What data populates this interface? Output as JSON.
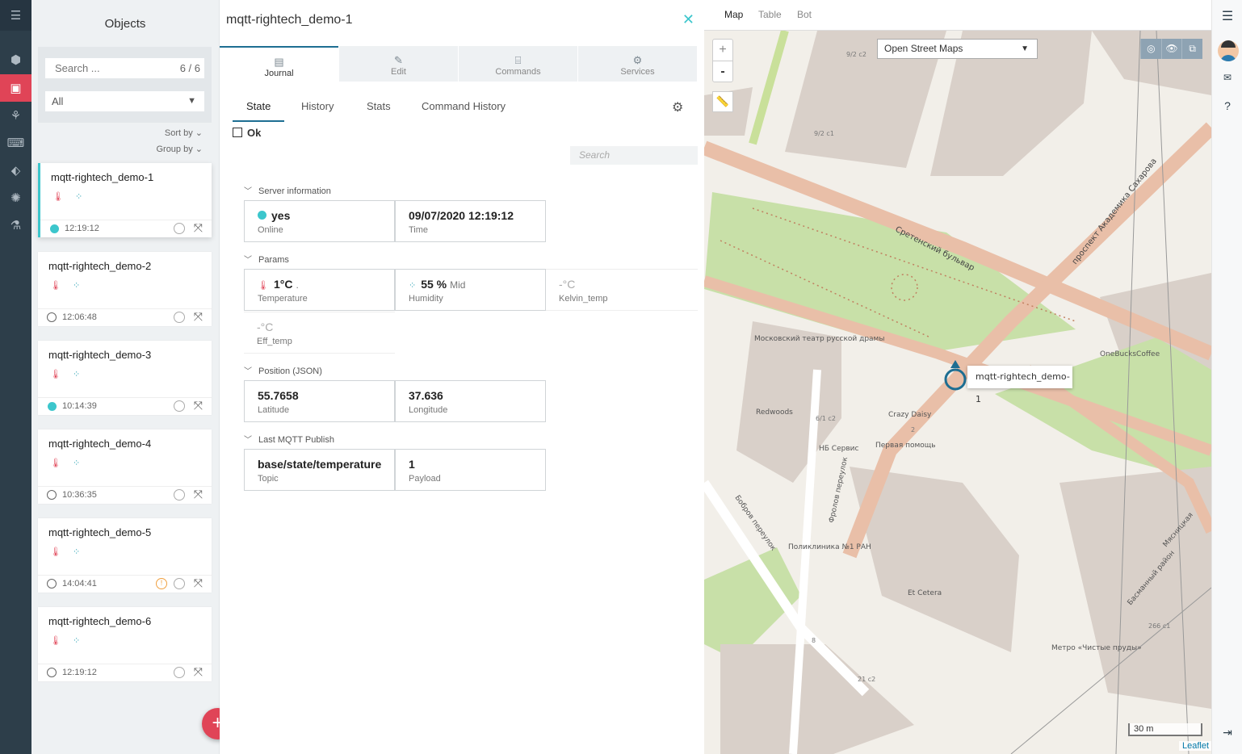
{
  "objects_panel": {
    "title": "Objects",
    "search_placeholder": "Search ...",
    "count": "6 / 6",
    "filter_value": "All",
    "sort_by": "Sort by",
    "group_by": "Group by",
    "add_button": "+",
    "cards": [
      {
        "name": "mqtt-rightech_demo-1",
        "time": "12:19:12",
        "status": "online",
        "active": true
      },
      {
        "name": "mqtt-rightech_demo-2",
        "time": "12:06:48",
        "status": "offline"
      },
      {
        "name": "mqtt-rightech_demo-3",
        "time": "10:14:39",
        "status": "online"
      },
      {
        "name": "mqtt-rightech_demo-4",
        "time": "10:36:35",
        "status": "offline"
      },
      {
        "name": "mqtt-rightech_demo-5",
        "time": "14:04:41",
        "status": "offline",
        "warning": true
      },
      {
        "name": "mqtt-rightech_demo-6",
        "time": "12:19:12",
        "status": "offline"
      }
    ]
  },
  "detail": {
    "title": "mqtt-rightech_demo-1",
    "tabs": [
      "Journal",
      "Edit",
      "Commands",
      "Services"
    ],
    "subtabs": [
      "State",
      "History",
      "Stats",
      "Command History"
    ],
    "state_label": "Ok",
    "search_placeholder": "Search",
    "sections": {
      "server": "Server information",
      "params": "Params",
      "position": "Position (JSON)",
      "mqtt": "Last MQTT Publish"
    },
    "server": {
      "online_value": "yes",
      "online_label": "Online",
      "time_value": "09/07/2020 12:19:12",
      "time_label": "Time"
    },
    "params": {
      "temp_value": "1°C",
      "temp_sub": ".",
      "temp_label": "Temperature",
      "hum_value": "55 %",
      "hum_sub": "Mid",
      "hum_label": "Humidity",
      "kelvin_value": "-°C",
      "kelvin_label": "Kelvin_temp",
      "eff_value": "-°C",
      "eff_label": "Eff_temp"
    },
    "position": {
      "lat_value": "55.7658",
      "lat_label": "Latitude",
      "lon_value": "37.636",
      "lon_label": "Longitude"
    },
    "mqtt": {
      "topic_value": "base/state/temperature",
      "topic_label": "Topic",
      "payload_value": "1",
      "payload_label": "Payload"
    }
  },
  "map": {
    "tabs": [
      "Map",
      "Table",
      "Bot"
    ],
    "layer": "Open Street Maps",
    "popup": "mqtt-rightech_demo-1",
    "scale": "30 m",
    "attribution": "Leaflet",
    "labels": [
      "Сретенский бульвар",
      "проспект Академика Сахарова",
      "Московский театр русской драмы",
      "Redwoods",
      "Crazy Daisy",
      "НБ Сервис",
      "Первая помощь",
      "Фролов переулок",
      "Бобров переулок",
      "Поликлиника №1 РАН",
      "Et Cetera",
      "OneBucksCoffee",
      "Метро «Чистые пруды»",
      "Мясницкая",
      "Басманный район",
      "9/2 с2",
      "9/2 с1",
      "6/1 с2",
      "2",
      "8",
      "21 с2",
      "266 с1"
    ]
  },
  "colors": {
    "accent": "#e04457",
    "teal": "#3cc6cc",
    "rail": "#2d3e4a"
  }
}
